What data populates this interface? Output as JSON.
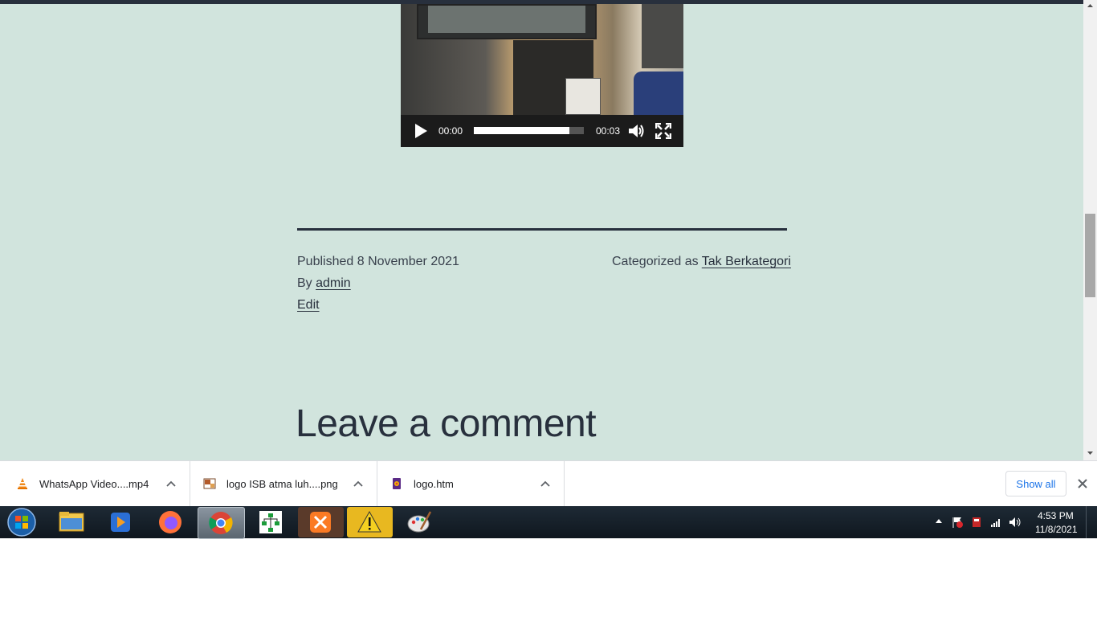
{
  "video": {
    "time_current": "00:00",
    "time_total": "00:03",
    "progress_fraction": 0.87
  },
  "post_meta": {
    "published_label": "Published",
    "published_date": "8 November 2021",
    "by_label": "By",
    "author": "admin",
    "edit_label": "Edit",
    "category_label": "Categorized as",
    "category": "Tak Berkategori"
  },
  "comments": {
    "heading": "Leave a comment"
  },
  "downloads": {
    "items": [
      {
        "name": "WhatsApp Video....mp4",
        "icon": "vlc-cone-icon"
      },
      {
        "name": "logo ISB atma luh....png",
        "icon": "image-file-icon"
      },
      {
        "name": "logo.htm",
        "icon": "html-file-icon"
      }
    ],
    "show_all_label": "Show all"
  },
  "taskbar": {
    "apps": [
      "windows-explorer",
      "media-player",
      "firefox",
      "chrome",
      "network-diagram",
      "xampp",
      "warning-app",
      "paint"
    ],
    "active_app": "chrome",
    "clock_time": "4:53 PM",
    "clock_date": "11/8/2021"
  },
  "colors": {
    "page_background": "#d1e4dd",
    "text_dark": "#28303d",
    "chrome_link_blue": "#1a73e8"
  }
}
